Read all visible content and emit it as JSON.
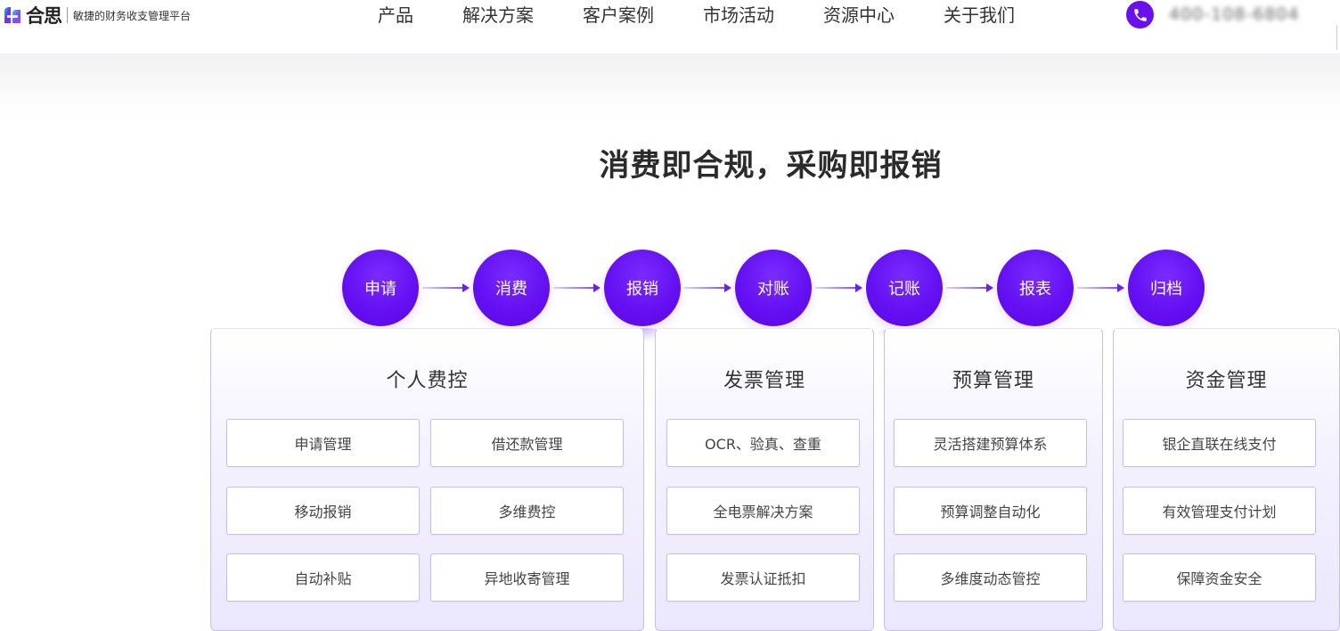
{
  "header": {
    "logo_text": "合思",
    "slogan": "敏捷的财务收支管理平台",
    "nav": [
      "产品",
      "解决方案",
      "客户案例",
      "市场活动",
      "资源中心",
      "关于我们"
    ],
    "phone_number": "400-108-6804",
    "accent_color": "#6a0ff0"
  },
  "main": {
    "title": "消费即合规，采购即报销",
    "flow_steps": [
      "申请",
      "消费",
      "报销",
      "对账",
      "记账",
      "报表",
      "归档"
    ],
    "panels": [
      {
        "title": "个人费控",
        "items": [
          "申请管理",
          "借还款管理",
          "移动报销",
          "多维费控",
          "自动补贴",
          "异地收寄管理"
        ]
      },
      {
        "title": "发票管理",
        "items": [
          "OCR、验真、查重",
          "全电票解决方案",
          "发票认证抵扣"
        ]
      },
      {
        "title": "预算管理",
        "items": [
          "灵活搭建预算体系",
          "预算调整自动化",
          "多维度动态管控"
        ]
      },
      {
        "title": "资金管理",
        "items": [
          "银企直联在线支付",
          "有效管理支付计划",
          "保障资金安全"
        ]
      }
    ]
  }
}
